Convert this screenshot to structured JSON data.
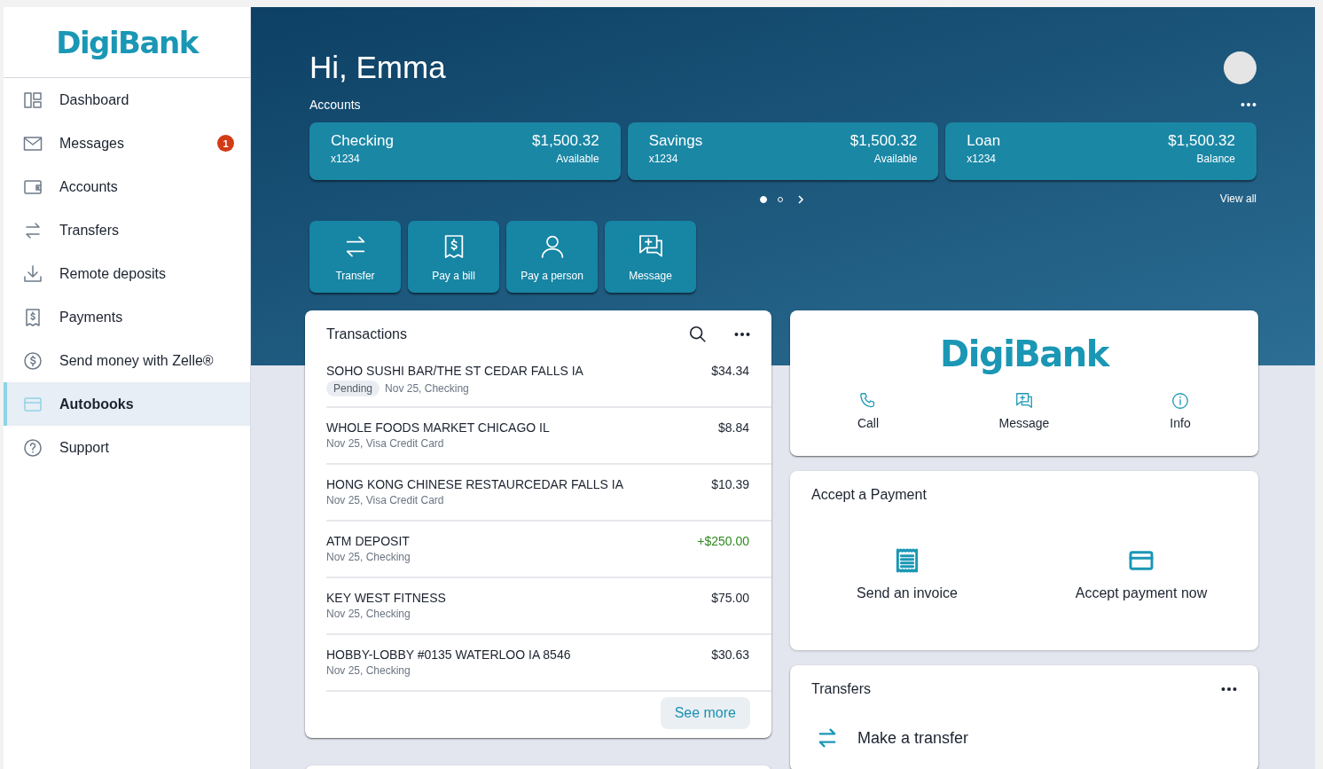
{
  "sidebar": {
    "logo": "DigiBank",
    "items": [
      {
        "label": "Dashboard",
        "kind": "dashboard",
        "selected": false
      },
      {
        "label": "Messages",
        "kind": "mail",
        "selected": false,
        "badge": "1"
      },
      {
        "label": "Accounts",
        "kind": "wallet",
        "selected": false
      },
      {
        "label": "Transfers",
        "kind": "transfer",
        "selected": false
      },
      {
        "label": "Remote deposits",
        "kind": "download",
        "selected": false
      },
      {
        "label": "Payments",
        "kind": "receipt",
        "selected": false
      },
      {
        "label": "Send money with Zelle®",
        "kind": "dollar",
        "selected": false
      },
      {
        "label": "Autobooks",
        "kind": "card",
        "selected": true
      },
      {
        "label": "Support",
        "kind": "help",
        "selected": false
      }
    ]
  },
  "greeting": "Hi, Emma",
  "accounts": {
    "title": "Accounts",
    "cards": [
      {
        "name": "Checking",
        "number": "x1234",
        "amount": "$1,500.32",
        "caption": "Available"
      },
      {
        "name": "Savings",
        "number": "x1234",
        "amount": "$1,500.32",
        "caption": "Available"
      },
      {
        "name": "Loan",
        "number": "x1234",
        "amount": "$1,500.32",
        "caption": "Balance"
      }
    ],
    "dots": [
      {
        "selected": true
      },
      {
        "selected": false
      }
    ],
    "view_all": "View all"
  },
  "quick_actions": [
    {
      "label": "Transfer",
      "kind": "transfer"
    },
    {
      "label": "Pay a bill",
      "kind": "receipt"
    },
    {
      "label": "Pay a person",
      "kind": "person"
    },
    {
      "label": "Message",
      "kind": "message"
    }
  ],
  "transactions": {
    "title": "Transactions",
    "rows": [
      {
        "name": "SOHO SUSHI BAR/THE ST CEDAR FALLS IA",
        "amount": "$34.34",
        "credit": false,
        "status": "Pending",
        "meta": "Nov 25, Checking"
      },
      {
        "name": "WHOLE FOODS MARKET CHICAGO IL",
        "amount": "$8.84",
        "credit": false,
        "meta": "Nov 25, Visa Credit Card"
      },
      {
        "name": "HONG KONG CHINESE RESTAURCEDAR FALLS IA",
        "amount": "$10.39",
        "credit": false,
        "meta": "Nov 25, Visa Credit Card"
      },
      {
        "name": "ATM DEPOSIT",
        "amount": "+$250.00",
        "credit": true,
        "meta": "Nov 25, Checking"
      },
      {
        "name": "KEY WEST FITNESS",
        "amount": "$75.00",
        "credit": false,
        "meta": "Nov 25, Checking"
      },
      {
        "name": "HOBBY-LOBBY #0135 WATERLOO IA 8546",
        "amount": "$30.63",
        "credit": false,
        "meta": "Nov 25, Checking"
      }
    ],
    "see_more": "See more"
  },
  "contact": {
    "logo": "DigiBank",
    "actions": [
      {
        "label": "Call",
        "kind": "phone"
      },
      {
        "label": "Message",
        "kind": "message"
      },
      {
        "label": "Info",
        "kind": "info"
      }
    ]
  },
  "accept_payment": {
    "title": "Accept a Payment",
    "actions": [
      {
        "label": "Send an invoice",
        "kind": "invoice"
      },
      {
        "label": "Accept payment now",
        "kind": "card"
      }
    ]
  },
  "transfers": {
    "title": "Transfers",
    "action": "Make a transfer"
  }
}
